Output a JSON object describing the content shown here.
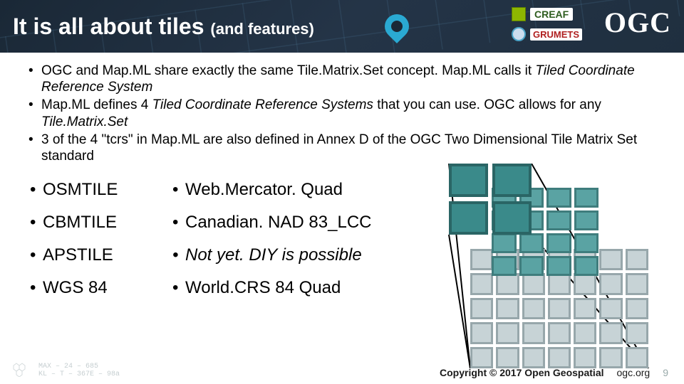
{
  "header": {
    "title_main": "It is all about tiles ",
    "title_sub": "(and features)",
    "logos": {
      "creaf": "CREAF",
      "grumets": "GRUMETS"
    },
    "ogc": "OGC"
  },
  "bullets": [
    {
      "pre": "OGC and Map.ML share exactly the same Tile.Matrix.Set concept. Map.ML calls it ",
      "em": "Tiled Coordinate Reference System",
      "post": ""
    },
    {
      "pre": "Map.ML defines 4 ",
      "em": "Tiled Coordinate Reference Systems",
      "post": " that you can use. OGC allows for any ",
      "em2": "Tile.Matrix.Set"
    },
    {
      "pre": "3 of the 4 \"tcrs\" in Map.ML are also defined in Annex D of the OGC Two Dimensional Tile Matrix Set standard",
      "em": "",
      "post": ""
    }
  ],
  "table": [
    {
      "a": "OSMTILE",
      "b": "Web.Mercator. Quad",
      "b_italic": false
    },
    {
      "a": "CBMTILE",
      "b": "Canadian. NAD 83_LCC",
      "b_italic": false
    },
    {
      "a": "APSTILE",
      "b": "Not yet. DIY is possible",
      "b_italic": true
    },
    {
      "a": "WGS 84",
      "b": "World.CRS 84 Quad",
      "b_italic": false
    }
  ],
  "footer": {
    "copyright": "Copyright © 2017 Open Geospatial",
    "url": "ogc.org",
    "page": "9"
  },
  "hud": {
    "line1": "MAX – 24 – 685",
    "line2": "KL – T – 367E – 98a"
  }
}
